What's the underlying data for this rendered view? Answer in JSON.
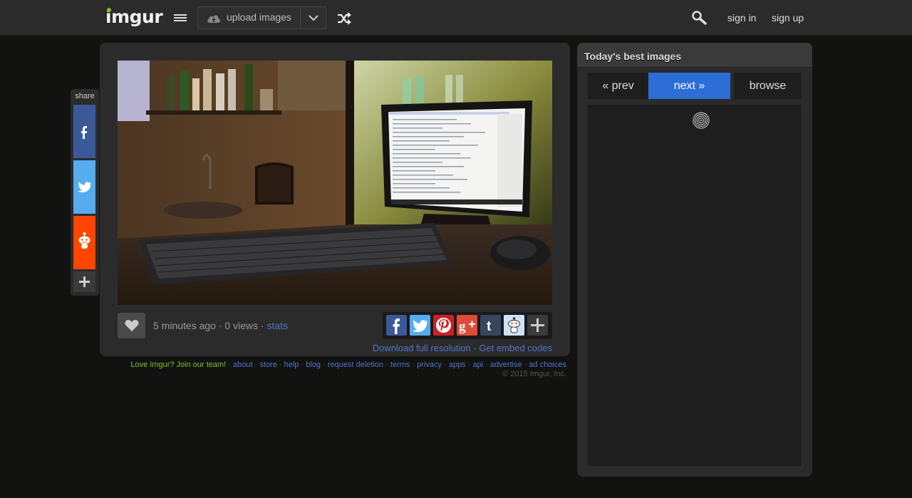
{
  "header": {
    "logo": "imgur",
    "upload_label": "upload images",
    "signin_label": "sign in",
    "signup_label": "sign up"
  },
  "share": {
    "label": "share"
  },
  "post": {
    "time": "5 minutes ago",
    "views": "0 views",
    "stats_label": "stats",
    "download_label": "Download full resolution",
    "embed_label": "Get embed codes"
  },
  "footer": {
    "join": "Love Imgur? Join our team!",
    "links": [
      "about",
      "store",
      "help",
      "blog",
      "request deletion",
      "terms",
      "privacy",
      "apps",
      "api",
      "advertise",
      "ad choices"
    ],
    "copyright": "© 2015 Imgur, Inc."
  },
  "sidebar": {
    "title": "Today's best images",
    "prev_label": "« prev",
    "next_label": "next »",
    "browse_label": "browse"
  },
  "colors": {
    "accent": "#2c6dd8",
    "link": "#4e76c9",
    "brand_green": "#85bf25"
  }
}
